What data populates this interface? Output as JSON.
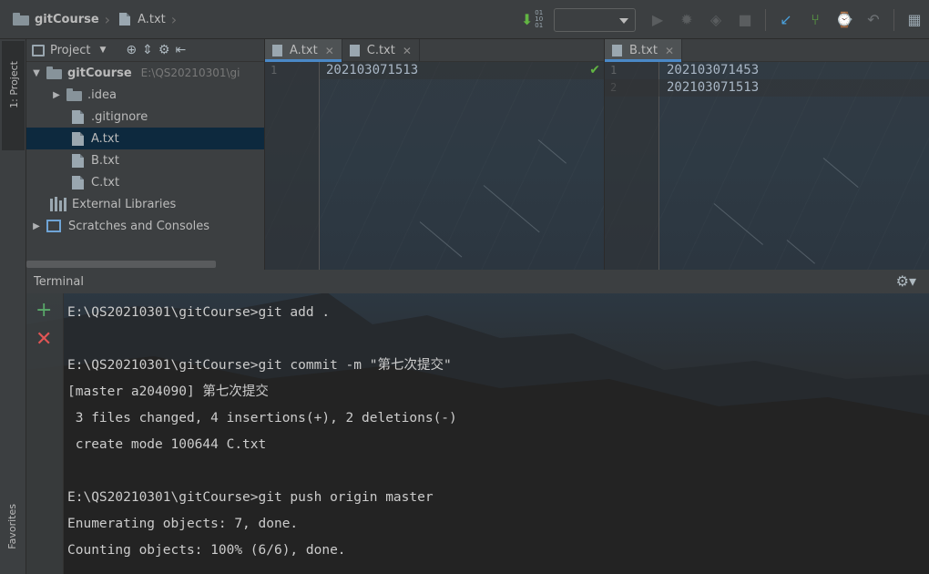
{
  "breadcrumb": {
    "project": "gitCourse",
    "file": "A.txt"
  },
  "toolbar": {
    "binary_icon_text": "01\n10\n01",
    "icons": [
      "vcs-update-icon",
      "run-icon",
      "debug-icon",
      "coverage-icon",
      "stop-icon",
      "vcs-commit-icon",
      "vcs-branch-icon",
      "vcs-history-icon",
      "revert-icon",
      "project-structure-icon"
    ]
  },
  "left_strip": {
    "project_label": "1: Project",
    "favorites_label": "Favorites"
  },
  "project_panel": {
    "title": "Project",
    "tree": [
      {
        "label": "gitCourse",
        "hint": "E:\\QS20210301\\gi",
        "kind": "folder",
        "expanded": true,
        "depth": 0,
        "bold": true
      },
      {
        "label": ".idea",
        "kind": "folder",
        "expanded": false,
        "depth": 1
      },
      {
        "label": ".gitignore",
        "kind": "file",
        "depth": 1
      },
      {
        "label": "A.txt",
        "kind": "file",
        "depth": 1,
        "selected": true
      },
      {
        "label": "B.txt",
        "kind": "file",
        "depth": 1
      },
      {
        "label": "C.txt",
        "kind": "file",
        "depth": 1
      },
      {
        "label": "External Libraries",
        "kind": "library",
        "depth": 0
      },
      {
        "label": "Scratches and Consoles",
        "kind": "scratch",
        "expanded": false,
        "depth": 0
      }
    ]
  },
  "editor_left": {
    "tabs": [
      {
        "label": "A.txt",
        "active": true
      },
      {
        "label": "C.txt",
        "active": false
      }
    ],
    "lines": [
      {
        "no": "1",
        "text": "202103071513"
      }
    ]
  },
  "editor_right": {
    "tabs": [
      {
        "label": "B.txt",
        "active": true
      }
    ],
    "lines": [
      {
        "no": "1",
        "text": "202103071453"
      },
      {
        "no": "2",
        "text": "202103071513"
      }
    ]
  },
  "terminal": {
    "title": "Terminal",
    "lines": [
      "E:\\QS20210301\\gitCourse>git add .",
      "",
      "E:\\QS20210301\\gitCourse>git commit -m \"第七次提交\"",
      "[master a204090] 第七次提交",
      " 3 files changed, 4 insertions(+), 2 deletions(-)",
      " create mode 100644 C.txt",
      "",
      "E:\\QS20210301\\gitCourse>git push origin master",
      "Enumerating objects: 7, done.",
      "Counting objects: 100% (6/6), done."
    ]
  },
  "colors": {
    "selection": "#0d293e",
    "accent": "#4a88c7",
    "add": "#59a869",
    "close": "#e05555",
    "check": "#62b543"
  }
}
